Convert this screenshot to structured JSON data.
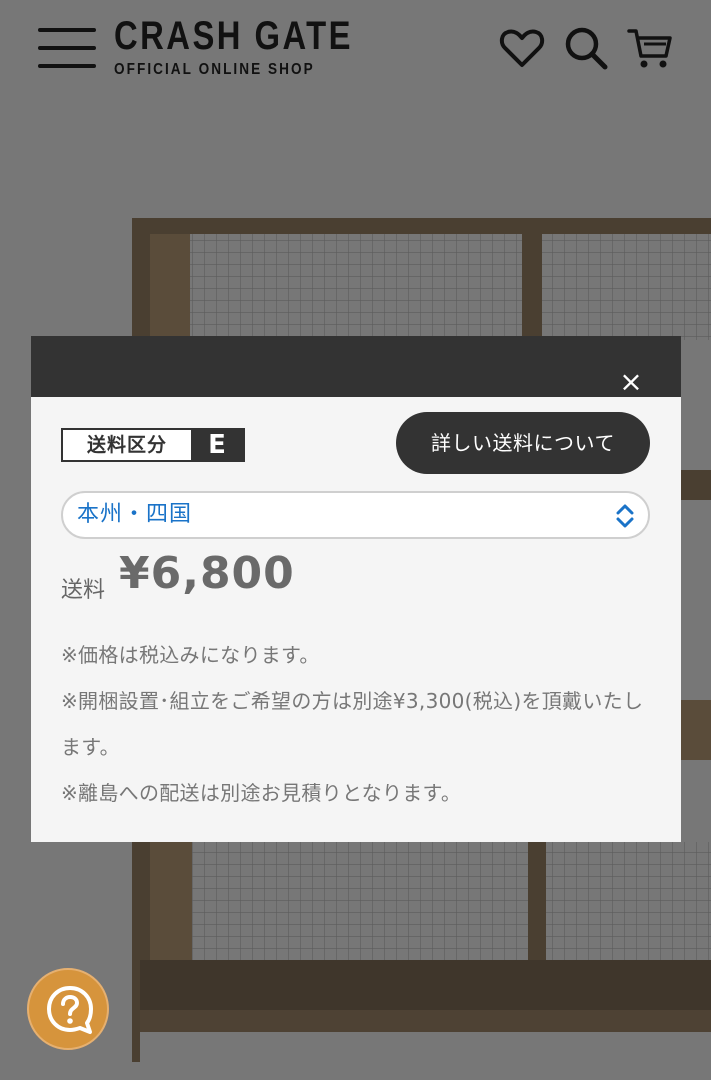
{
  "header": {
    "menu_icon": "hamburger-menu-icon",
    "logo_main": "CRASH GATE",
    "logo_sub": "OFFICIAL ONLINE SHOP",
    "icons": [
      "heart-icon",
      "search-icon",
      "cart-icon"
    ]
  },
  "modal": {
    "close_label": "×",
    "shipping_class_label": "送料区分",
    "shipping_class_value": "E",
    "detail_button": "詳しい送料について",
    "region_selected": "本州・四国",
    "price_label": "送料",
    "price_value": "¥6,800",
    "notes": [
      "※価格は税込みになります。",
      "※開梱設置･組立をご希望の方は別途¥3,300(税込)を頂戴いたします。",
      "※離島への配送は別途お見積りとなります。"
    ]
  },
  "help_button": {
    "icon": "help-chat-icon"
  },
  "colors": {
    "overlay": "#777777",
    "modal_bar": "#333333",
    "accent_link": "#1a73c8",
    "help_button": "#d6943c"
  }
}
